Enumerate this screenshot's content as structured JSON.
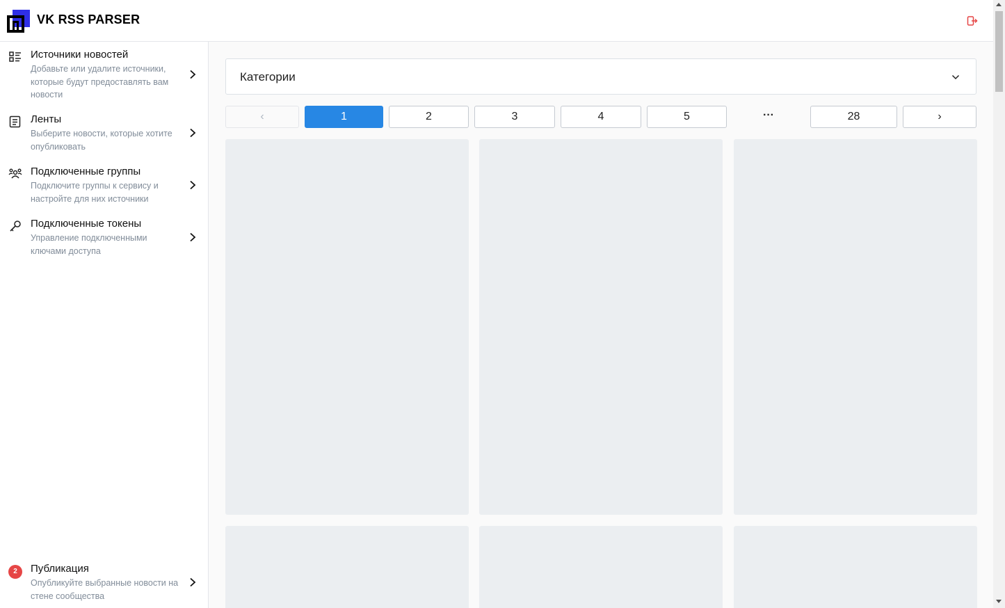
{
  "app": {
    "title": "VK RSS PARSER",
    "logo_icon": "logo-icon",
    "logout_icon": "logout-icon",
    "accent_color": "#2787e4",
    "logout_color": "#e64646"
  },
  "sidebar": {
    "items": [
      {
        "icon": "list-icon",
        "title": "Источники новостей",
        "desc": "Добавьте или удалите источники, которые будут предоставлять вам новости"
      },
      {
        "icon": "feed-icon",
        "title": "Ленты",
        "desc": "Выберите новости, которые хотите опубликовать"
      },
      {
        "icon": "groups-icon",
        "title": "Подключенные группы",
        "desc": "Подключите группы к сервису и настройте для них источники"
      },
      {
        "icon": "key-icon",
        "title": "Подключенные токены",
        "desc": "Управление подключенными ключами доступа"
      }
    ],
    "publish": {
      "badge": "2",
      "title": "Публикация",
      "desc": "Опубликуйте выбранные новости на стене сообщества"
    }
  },
  "main": {
    "category_select": {
      "label": "Категории",
      "icon": "chevron-down-icon"
    },
    "pagination": {
      "prev": "‹",
      "pages": [
        "1",
        "2",
        "3",
        "4",
        "5"
      ],
      "ellipsis": "···",
      "last": "28",
      "next": "›",
      "current_page": "1"
    }
  }
}
